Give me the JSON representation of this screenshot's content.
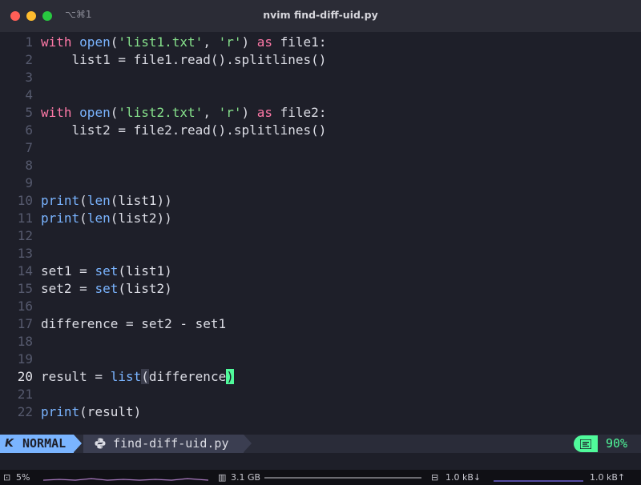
{
  "window": {
    "tab_shortcut": "⌥⌘1",
    "title": "nvim find-diff-uid.py"
  },
  "editor": {
    "current_line": 20,
    "lines": [
      {
        "n": "1",
        "tokens": [
          [
            "kw",
            "with"
          ],
          [
            "p",
            " "
          ],
          [
            "fn",
            "open"
          ],
          [
            "p",
            "("
          ],
          [
            "str",
            "'list1.txt'"
          ],
          [
            "p",
            ", "
          ],
          [
            "str",
            "'r'"
          ],
          [
            "p",
            ") "
          ],
          [
            "kw",
            "as"
          ],
          [
            "p",
            " file1:"
          ]
        ]
      },
      {
        "n": "2",
        "tokens": [
          [
            "p",
            "    list1 = file1.read().splitlines()"
          ]
        ]
      },
      {
        "n": "3",
        "tokens": []
      },
      {
        "n": "4",
        "tokens": []
      },
      {
        "n": "5",
        "tokens": [
          [
            "kw",
            "with"
          ],
          [
            "p",
            " "
          ],
          [
            "fn",
            "open"
          ],
          [
            "p",
            "("
          ],
          [
            "str",
            "'list2.txt'"
          ],
          [
            "p",
            ", "
          ],
          [
            "str",
            "'r'"
          ],
          [
            "p",
            ") "
          ],
          [
            "kw",
            "as"
          ],
          [
            "p",
            " file2:"
          ]
        ]
      },
      {
        "n": "6",
        "tokens": [
          [
            "p",
            "    list2 = file2.read().splitlines()"
          ]
        ]
      },
      {
        "n": "7",
        "tokens": []
      },
      {
        "n": "8",
        "tokens": []
      },
      {
        "n": "9",
        "tokens": []
      },
      {
        "n": "10",
        "tokens": [
          [
            "fn",
            "print"
          ],
          [
            "p",
            "("
          ],
          [
            "fn",
            "len"
          ],
          [
            "p",
            "(list1))"
          ]
        ]
      },
      {
        "n": "11",
        "tokens": [
          [
            "fn",
            "print"
          ],
          [
            "p",
            "("
          ],
          [
            "fn",
            "len"
          ],
          [
            "p",
            "(list2))"
          ]
        ]
      },
      {
        "n": "12",
        "tokens": []
      },
      {
        "n": "13",
        "tokens": []
      },
      {
        "n": "14",
        "tokens": [
          [
            "p",
            "set1 = "
          ],
          [
            "fn",
            "set"
          ],
          [
            "p",
            "(list1)"
          ]
        ]
      },
      {
        "n": "15",
        "tokens": [
          [
            "p",
            "set2 = "
          ],
          [
            "fn",
            "set"
          ],
          [
            "p",
            "(list2)"
          ]
        ]
      },
      {
        "n": "16",
        "tokens": []
      },
      {
        "n": "17",
        "tokens": [
          [
            "p",
            "difference = set2 - set1"
          ]
        ]
      },
      {
        "n": "18",
        "tokens": []
      },
      {
        "n": "19",
        "tokens": []
      },
      {
        "n": "20",
        "tokens": [
          [
            "p",
            "result = "
          ],
          [
            "fn",
            "list"
          ],
          [
            "match",
            "("
          ],
          [
            "p",
            "difference"
          ],
          [
            "cursor",
            ")"
          ]
        ]
      },
      {
        "n": "21",
        "tokens": []
      },
      {
        "n": "22",
        "tokens": [
          [
            "fn",
            "print"
          ],
          [
            "p",
            "(result)"
          ]
        ]
      }
    ]
  },
  "statusline": {
    "mode": "NORMAL",
    "mode_icon": "neovim-logo-icon",
    "file_icon": "python-icon",
    "filename": "find-diff-uid.py",
    "position_icon": "lines-icon",
    "position": "90%",
    "colors": {
      "mode": "#7ab4ff",
      "position": "#50fa9b"
    }
  },
  "sysbar": {
    "cpu": "5%",
    "memory": "3.1 GB",
    "net_down": "1.0 kB↓",
    "net_up": "1.0 kB↑"
  }
}
